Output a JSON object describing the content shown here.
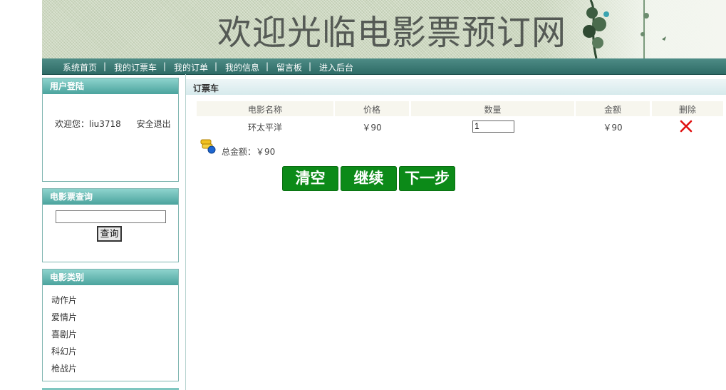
{
  "banner": {
    "title": "欢迎光临电影票预订网"
  },
  "nav": {
    "items": [
      "系统首页",
      "我的订票车",
      "我的订单",
      "我的信息",
      "留言板",
      "进入后台"
    ],
    "separator": "|"
  },
  "sidebar": {
    "login": {
      "title": "用户登陆",
      "welcome": "欢迎您：liu3718",
      "logout": "安全退出"
    },
    "search": {
      "title": "电影票查询",
      "input_value": "",
      "button_label": "查询"
    },
    "categories": {
      "title": "电影类别",
      "items": [
        "动作片",
        "爱情片",
        "喜剧片",
        "科幻片",
        "枪战片"
      ]
    }
  },
  "cart": {
    "title": "订票车",
    "columns": [
      "电影名称",
      "价格",
      "数量",
      "金额",
      "删除"
    ],
    "rows": [
      {
        "name": "环太平洋",
        "price": "￥90",
        "quantity": "1",
        "amount": "￥90"
      }
    ],
    "total_label": "总金额：￥90",
    "buttons": {
      "clear": "清空",
      "continue": "继续",
      "next": "下一步"
    }
  },
  "colors": {
    "nav_bg": "#2e6b66",
    "box_header": "#4aa39d",
    "button_green": "#0c8a18",
    "delete_red": "#e01010"
  },
  "icons": {
    "delete": "red-x-icon",
    "total": "coins-icon"
  }
}
